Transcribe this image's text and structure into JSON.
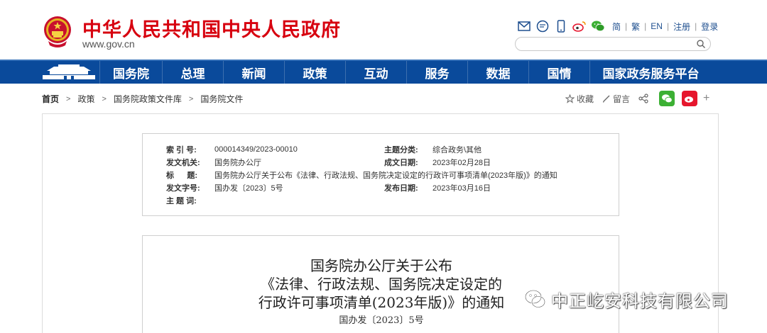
{
  "header": {
    "title": "中华人民共和国中央人民政府",
    "url": "www.gov.cn",
    "lang_links": [
      "简",
      "繁",
      "EN",
      "注册",
      "登录"
    ],
    "search": {
      "placeholder": ""
    }
  },
  "nav": {
    "items": [
      "国务院",
      "总理",
      "新闻",
      "政策",
      "互动",
      "服务",
      "数据",
      "国情",
      "国家政务服务平台"
    ]
  },
  "breadcrumb": {
    "items": [
      "首页",
      "政策",
      "国务院政策文件库",
      "国务院文件"
    ]
  },
  "tools": {
    "collect": "收藏",
    "comment": "留言",
    "plus": "+"
  },
  "info": {
    "index_label": "索 引 号:",
    "index_value": "000014349/2023-00010",
    "category_label": "主题分类:",
    "category_value": "综合政务\\其他",
    "issuer_label": "发文机关:",
    "issuer_value": "国务院办公厅",
    "written_label": "成文日期:",
    "written_value": "2023年02月28日",
    "title_label": "标      题:",
    "title_value": "国务院办公厅关于公布《法律、行政法规、国务院决定设定的行政许可事项清单(2023年版)》的通知",
    "docno_label": "发文字号:",
    "docno_value": "国办发〔2023〕5号",
    "published_label": "发布日期:",
    "published_value": "2023年03月16日",
    "keywords_label": "主 题 词:"
  },
  "document": {
    "title_line1": "国务院办公厅关于公布",
    "title_line2": "《法律、行政法规、国务院决定设定的",
    "title_line3": "行政许可事项清单(2023年版)》的通知",
    "doc_number": "国办发〔2023〕5号"
  },
  "watermark": {
    "text": "中正屹安科技有限公司"
  },
  "colors": {
    "brand_red": "#d7000f",
    "nav_blue": "#0a4a9b",
    "link_blue": "#1e4f8f"
  }
}
